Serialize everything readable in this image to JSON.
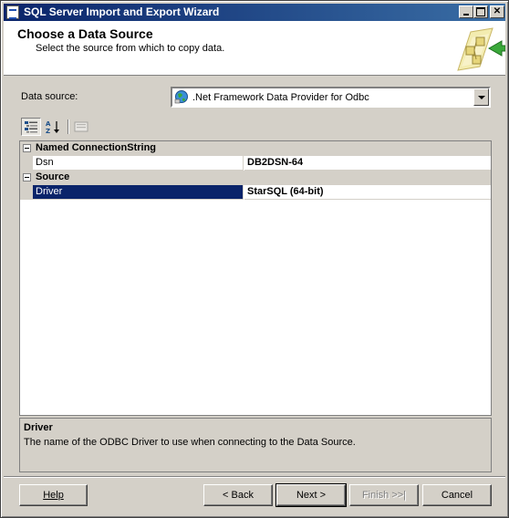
{
  "window": {
    "title": "SQL Server Import and Export Wizard"
  },
  "header": {
    "title": "Choose a Data Source",
    "subtitle": "Select the source from which to copy data."
  },
  "data_source": {
    "label": "Data source:",
    "selected": ".Net Framework Data Provider for Odbc",
    "icon": "globe-provider-icon"
  },
  "toolbar": {
    "categorized_icon": "categorized-icon",
    "alphabetical_icon": "alphabetical-sort-icon",
    "property_pages_icon": "property-pages-icon"
  },
  "property_grid": {
    "categories": [
      {
        "name": "Named ConnectionString",
        "properties": [
          {
            "name": "Dsn",
            "value": "DB2DSN-64",
            "selected": false
          }
        ]
      },
      {
        "name": "Source",
        "properties": [
          {
            "name": "Driver",
            "value": "StarSQL (64-bit)",
            "selected": true
          }
        ]
      }
    ]
  },
  "description": {
    "title": "Driver",
    "text": "The name of the ODBC Driver to use when connecting to the Data Source."
  },
  "buttons": {
    "help": "Help",
    "back": "< Back",
    "next": "Next >",
    "finish": "Finish >>|",
    "cancel": "Cancel"
  },
  "colors": {
    "selection": "#0a246a",
    "title_bar": "#0a246a",
    "face": "#d4d0c8"
  }
}
